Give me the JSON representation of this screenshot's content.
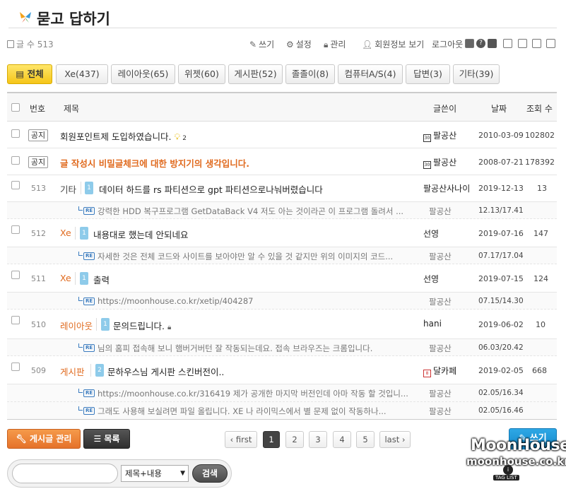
{
  "page": {
    "title": "묻고 답하기"
  },
  "meta": {
    "post_count": "글 수 513",
    "toolbar": {
      "write": "쓰기",
      "settings": "설정",
      "manage": "관리",
      "profile": "회원정보 보기",
      "logout": "로그아웃"
    },
    "icons": [
      "rss-icon",
      "help-icon",
      "tag-icon",
      "list-view-icon",
      "webzine-view-icon",
      "gallery-view-icon",
      "grid-view-icon"
    ]
  },
  "tabs": [
    {
      "label": "전체",
      "active": true
    },
    {
      "label": "Xe(437)"
    },
    {
      "label": "레이아웃(65)"
    },
    {
      "label": "위젯(60)"
    },
    {
      "label": "게시판(52)"
    },
    {
      "label": "졸졸이(8)"
    },
    {
      "label": "컴퓨터A/S(4)"
    },
    {
      "label": "답변(3)"
    },
    {
      "label": "기타(39)"
    }
  ],
  "columns": {
    "no": "번호",
    "title": "제목",
    "author": "글쓴이",
    "date": "날짜",
    "views": "조회 수"
  },
  "notices": [
    {
      "badge": "공지",
      "title": "회원포인트제 도입하였습니다.",
      "comments": "2",
      "level": "30",
      "author": "팔공산",
      "date": "2010-03-09",
      "views": "102802"
    },
    {
      "badge": "공지",
      "title": "글 작성시 비밀글체크에 대한 방지기의 생각입니다.",
      "level": "30",
      "author": "팔공산",
      "date": "2008-07-21",
      "views": "178392"
    }
  ],
  "posts": [
    {
      "no": "513",
      "category": "기타",
      "replies": "1",
      "title": "데이터 하드를 rs 파티션으로 gpt 파티션으로나눠버렸습니다",
      "author": "팔공산사나이",
      "date": "2019-12-13",
      "views": "13",
      "reply_items": [
        {
          "text": "강력한 HDD 복구프로그램 GetDataBack V4 저도 아는 것이라곤 이 프로그램 돌려서 ...",
          "author": "팔공산",
          "date": "12.13/17.41"
        }
      ]
    },
    {
      "no": "512",
      "category": "Xe",
      "replies": "1",
      "title": "내용대로 했는데 안되네요",
      "author": "선영",
      "date": "2019-07-16",
      "views": "147",
      "reply_items": [
        {
          "text": "자세한 것은 전체 코드와 사이트를 보아야만 알 수 있을 것 같지만 위의 이미지의 코드...",
          "author": "팔공산",
          "date": "07.17/17.04"
        }
      ]
    },
    {
      "no": "511",
      "category": "Xe",
      "replies": "1",
      "title": "출력",
      "author": "선영",
      "date": "2019-07-15",
      "views": "124",
      "reply_items": [
        {
          "text": "https://moonhouse.co.kr/xetip/404287",
          "author": "팔공산",
          "date": "07.15/14.30"
        }
      ]
    },
    {
      "no": "510",
      "category": "레이아웃",
      "replies": "1",
      "title": "문의드립니다.",
      "author": "hani",
      "date": "2019-06-02",
      "views": "10",
      "reply_items": [
        {
          "text": "님의 홈피 접속해 보니 햄버거버턴 잘 작동되는데요. 접속 브라우즈는 크롬입니다.",
          "author": "팔공산",
          "date": "06.03/20.42"
        }
      ]
    },
    {
      "no": "509",
      "category": "게시판",
      "replies": "2",
      "title": "문하우스님 게시판 스킨버전이..",
      "level": "8",
      "author": "달카페",
      "date": "2019-02-05",
      "views": "668",
      "reply_items": [
        {
          "text": "https://moonhouse.co.kr/316419 제가 공개한 마지막 버전인데 아마 작동 할 것입니...",
          "author": "팔공산",
          "date": "02.05/16.34"
        },
        {
          "text": "그래도 사용해 보실려면 파일 올립니다. XE 나 라이믹스에서 별 문제 없이 작동하나...",
          "author": "팔공산",
          "date": "02.05/16.46"
        }
      ]
    }
  ],
  "buttons": {
    "manage": "게시글 관리",
    "list": "목록",
    "write": "쓰기"
  },
  "pagination": {
    "first": "first",
    "pages": [
      "1",
      "2",
      "3",
      "4",
      "5"
    ],
    "current": "1",
    "last": "last"
  },
  "search": {
    "value": "",
    "select": "제목+내용",
    "button": "검색"
  },
  "watermark": {
    "line1": "MoonHouse",
    "line2": "moonhouse.co.kr",
    "tag": "TAG LIST"
  }
}
